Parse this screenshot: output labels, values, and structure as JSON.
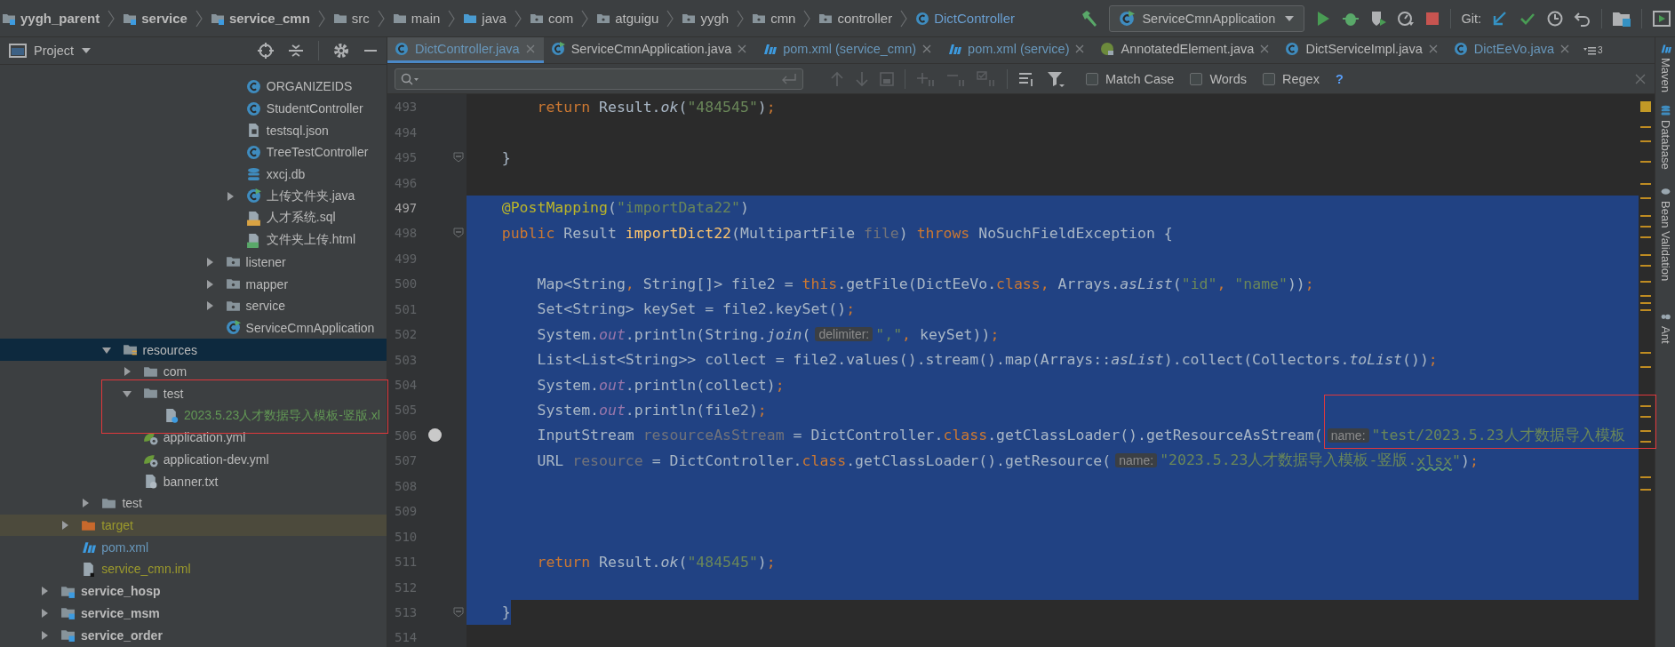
{
  "breadcrumb": [
    {
      "label": "yygh_parent",
      "kind": "module"
    },
    {
      "label": "service",
      "kind": "module"
    },
    {
      "label": "service_cmn",
      "kind": "module"
    },
    {
      "label": "src",
      "kind": "folder"
    },
    {
      "label": "main",
      "kind": "folder"
    },
    {
      "label": "java",
      "kind": "source"
    },
    {
      "label": "com",
      "kind": "package"
    },
    {
      "label": "atguigu",
      "kind": "package"
    },
    {
      "label": "yygh",
      "kind": "package"
    },
    {
      "label": "cmn",
      "kind": "package"
    },
    {
      "label": "controller",
      "kind": "package"
    },
    {
      "label": "DictController",
      "kind": "class"
    }
  ],
  "run_config": {
    "label": "ServiceCmnApplication",
    "kind": "class-run"
  },
  "git": {
    "label": "Git:"
  },
  "project_panel": {
    "title": "Project",
    "tree": [
      {
        "children": [
          {
            "children": [
              {
                "children": [
                  {
                    "children": [
                      {
                        "children": [
                          {
                            "children": [
                              {
                                "children": [
                                  {
                                    "children": [
                                      {
                                        "children": [
                                          {
                                            "label": "ORGANIZEIDS",
                                            "kind": "class",
                                            "selected": false
                                          },
                                          {
                                            "label": "StudentController",
                                            "kind": "class",
                                            "selected": false
                                          },
                                          {
                                            "label": "testsql.json",
                                            "kind": "json",
                                            "selected": false
                                          },
                                          {
                                            "label": "TreeTestController",
                                            "kind": "class",
                                            "selected": false
                                          },
                                          {
                                            "label": "xxcj.db",
                                            "kind": "db",
                                            "selected": false
                                          },
                                          {
                                            "label": "上传文件夹.java",
                                            "kind": "class-run",
                                            "expanded": false,
                                            "selected": false
                                          },
                                          {
                                            "label": "人才系统.sql",
                                            "kind": "sql",
                                            "selected": false
                                          },
                                          {
                                            "label": "文件夹上传.html",
                                            "kind": "html",
                                            "selected": false
                                          }
                                        ]
                                      },
                                      {
                                        "label": "listener",
                                        "kind": "package",
                                        "expanded": false,
                                        "selected": false
                                      },
                                      {
                                        "label": "mapper",
                                        "kind": "package",
                                        "expanded": false,
                                        "selected": false
                                      },
                                      {
                                        "label": "service",
                                        "kind": "package",
                                        "expanded": false,
                                        "selected": false
                                      },
                                      {
                                        "label": "ServiceCmnApplication",
                                        "kind": "class-run",
                                        "selected": false
                                      }
                                    ]
                                  }
                                ]
                              }
                            ]
                          }
                        ]
                      }
                    ]
                  },
                  {
                    "label": "resources",
                    "kind": "resources",
                    "expanded": true,
                    "selected": true,
                    "children": [
                      {
                        "label": "com",
                        "kind": "folder",
                        "expanded": false,
                        "selected": false
                      },
                      {
                        "label": "test",
                        "kind": "folder",
                        "expanded": true,
                        "selected": false,
                        "children": [
                          {
                            "label": "2023.5.23人才数据导入模板-竖版.xl",
                            "kind": "unknown",
                            "color": "#629755",
                            "selected": false
                          }
                        ]
                      },
                      {
                        "label": "application.yml",
                        "kind": "yml",
                        "selected": false
                      },
                      {
                        "label": "application-dev.yml",
                        "kind": "yml",
                        "selected": false
                      },
                      {
                        "label": "banner.txt",
                        "kind": "txt",
                        "selected": false
                      }
                    ]
                  }
                ]
              },
              {
                "label": "test",
                "kind": "folder",
                "expanded": false,
                "selected": false
              }
            ]
          },
          {
            "label": "target",
            "kind": "excluded",
            "expanded": false,
            "color": "#9c9a2c",
            "selected": false
          },
          {
            "label": "pom.xml",
            "kind": "maven",
            "color": "#6897bb",
            "selected": false
          },
          {
            "label": "service_cmn.iml",
            "kind": "iml",
            "color": "#9c9a2c",
            "selected": false
          }
        ]
      },
      {
        "label": "service_hosp",
        "kind": "module",
        "expanded": false,
        "selected": false
      },
      {
        "label": "service_msm",
        "kind": "module",
        "expanded": false,
        "selected": false
      },
      {
        "label": "service_order",
        "kind": "module",
        "expanded": false,
        "selected": false
      }
    ]
  },
  "tabs": [
    {
      "label": "DictController.java",
      "kind": "class",
      "modified": true,
      "selected": true
    },
    {
      "label": "ServiceCmnApplication.java",
      "kind": "class-run",
      "modified": false,
      "selected": false
    },
    {
      "label": "pom.xml (service_cmn)",
      "kind": "maven",
      "modified": true,
      "selected": false
    },
    {
      "label": "pom.xml (service)",
      "kind": "maven",
      "modified": true,
      "selected": false
    },
    {
      "label": "AnnotatedElement.java",
      "kind": "interface",
      "modified": false,
      "selected": false
    },
    {
      "label": "DictServiceImpl.java",
      "kind": "class",
      "modified": false,
      "selected": false
    },
    {
      "label": "DictEeVo.java",
      "kind": "class",
      "modified": true,
      "selected": false
    }
  ],
  "tab_overflow": "3",
  "search": {
    "options": [
      {
        "label": "Match Case",
        "checked": false
      },
      {
        "label": "Words",
        "checked": false
      },
      {
        "label": "Regex",
        "checked": false
      }
    ],
    "help": "?"
  },
  "editor": {
    "lines": [
      {
        "number": "493",
        "selected": false,
        "current": false,
        "breakpoint": false,
        "fold": false,
        "tokens": [
          {
            "text": "        return",
            "kind": "kw"
          },
          {
            "text": " Result."
          },
          {
            "text": "ok",
            "kind": "it"
          },
          {
            "text": "("
          },
          {
            "text": "\"484545\"",
            "kind": "str"
          },
          {
            "text": ")"
          },
          {
            "text": ";",
            "kind": "kw"
          }
        ]
      },
      {
        "number": "494",
        "selected": false,
        "current": false,
        "breakpoint": false,
        "fold": false
      },
      {
        "number": "495",
        "selected": false,
        "current": false,
        "breakpoint": false,
        "fold": true,
        "tokens": [
          {
            "text": "    }"
          }
        ]
      },
      {
        "number": "496",
        "selected": false,
        "current": false,
        "breakpoint": false,
        "fold": false
      },
      {
        "number": "497",
        "selected": true,
        "current": true,
        "breakpoint": false,
        "fold": false,
        "tokens": [
          {
            "text": "    @PostMapping",
            "kind": "ann"
          },
          {
            "text": "("
          },
          {
            "text": "\"importData22\"",
            "kind": "str"
          },
          {
            "text": ")"
          }
        ]
      },
      {
        "number": "498",
        "selected": true,
        "current": false,
        "breakpoint": false,
        "fold": true,
        "tokens": [
          {
            "text": "    public",
            "kind": "kw"
          },
          {
            "text": " Result "
          },
          {
            "text": "importDict22",
            "kind": "meth"
          },
          {
            "text": "(MultipartFile "
          },
          {
            "text": "file",
            "kind": "unused"
          },
          {
            "text": ") "
          },
          {
            "text": "throws",
            "kind": "kw"
          },
          {
            "text": " NoSuchFieldException {"
          }
        ]
      },
      {
        "number": "499",
        "selected": true,
        "current": false,
        "breakpoint": false,
        "fold": false
      },
      {
        "number": "500",
        "selected": true,
        "current": false,
        "breakpoint": false,
        "fold": false,
        "tokens": [
          {
            "text": "        Map<String"
          },
          {
            "text": ",",
            "kind": "kw"
          },
          {
            "text": " String[]> file2 = "
          },
          {
            "text": "this",
            "kind": "kw"
          },
          {
            "text": ".getFile(DictEeVo."
          },
          {
            "text": "class",
            "kind": "kw"
          },
          {
            "text": ",",
            "kind": "kw"
          },
          {
            "text": " Arrays."
          },
          {
            "text": "asList",
            "kind": "it"
          },
          {
            "text": "("
          },
          {
            "text": "\"id\"",
            "kind": "str"
          },
          {
            "text": ", ",
            "kind": "kw"
          },
          {
            "text": "\"name\"",
            "kind": "str"
          },
          {
            "text": "))"
          },
          {
            "text": ";",
            "kind": "kw"
          }
        ]
      },
      {
        "number": "501",
        "selected": true,
        "current": false,
        "breakpoint": false,
        "fold": false,
        "tokens": [
          {
            "text": "        Set<String> keySet = file2.keySet()"
          },
          {
            "text": ";",
            "kind": "kw"
          }
        ]
      },
      {
        "number": "502",
        "selected": true,
        "current": false,
        "breakpoint": false,
        "fold": false,
        "tokens": [
          {
            "text": "        System."
          },
          {
            "text": "out",
            "kind": "st"
          },
          {
            "text": ".println(String."
          },
          {
            "text": "join",
            "kind": "it"
          },
          {
            "text": "("
          },
          {
            "text": "delimiter:",
            "kind": "hint"
          },
          {
            "text": "\",\"",
            "kind": "str"
          },
          {
            "text": ",",
            "kind": "kw"
          },
          {
            "text": " keySet))"
          },
          {
            "text": ";",
            "kind": "kw"
          }
        ]
      },
      {
        "number": "503",
        "selected": true,
        "current": false,
        "breakpoint": false,
        "fold": false,
        "tokens": [
          {
            "text": "        List<List<String>> collect = file2.values().stream().map(Arrays::"
          },
          {
            "text": "asList",
            "kind": "it"
          },
          {
            "text": ").collect(Collectors."
          },
          {
            "text": "toList",
            "kind": "it"
          },
          {
            "text": "())"
          },
          {
            "text": ";",
            "kind": "kw"
          }
        ]
      },
      {
        "number": "504",
        "selected": true,
        "current": false,
        "breakpoint": false,
        "fold": false,
        "tokens": [
          {
            "text": "        System."
          },
          {
            "text": "out",
            "kind": "st"
          },
          {
            "text": ".println(collect)"
          },
          {
            "text": ";",
            "kind": "kw"
          }
        ]
      },
      {
        "number": "505",
        "selected": true,
        "current": false,
        "breakpoint": false,
        "fold": false,
        "tokens": [
          {
            "text": "        System."
          },
          {
            "text": "out",
            "kind": "st"
          },
          {
            "text": ".println(file2)"
          },
          {
            "text": ";",
            "kind": "kw"
          }
        ]
      },
      {
        "number": "506",
        "selected": true,
        "current": false,
        "breakpoint": true,
        "fold": false,
        "tokens": [
          {
            "text": "        InputStream "
          },
          {
            "text": "resourceAsStream",
            "kind": "unused"
          },
          {
            "text": " = DictController."
          },
          {
            "text": "class",
            "kind": "kw"
          },
          {
            "text": ".getClassLoader().getResourceAsStream("
          },
          {
            "text": "name:",
            "kind": "hint"
          },
          {
            "text": "\"test/2023.5.23人才数据导入模板",
            "kind": "str"
          }
        ]
      },
      {
        "number": "507",
        "selected": true,
        "current": false,
        "breakpoint": false,
        "fold": false,
        "tokens": [
          {
            "text": "        URL "
          },
          {
            "text": "resource",
            "kind": "unused"
          },
          {
            "text": " = DictController."
          },
          {
            "text": "class",
            "kind": "kw"
          },
          {
            "text": ".getClassLoader().getResource("
          },
          {
            "text": "name:",
            "kind": "hint"
          },
          {
            "text": "\"2023.5.23人才数据导入模板-竖版.",
            "kind": "str"
          },
          {
            "text": "xlsx",
            "kind": "typo"
          },
          {
            "text": "\"",
            "kind": "str"
          },
          {
            "text": ")"
          },
          {
            "text": ";",
            "kind": "kw"
          }
        ]
      },
      {
        "number": "508",
        "selected": true,
        "current": false,
        "breakpoint": false,
        "fold": false
      },
      {
        "number": "509",
        "selected": true,
        "current": false,
        "breakpoint": false,
        "fold": false
      },
      {
        "number": "510",
        "selected": true,
        "current": false,
        "breakpoint": false,
        "fold": false
      },
      {
        "number": "511",
        "selected": true,
        "current": false,
        "breakpoint": false,
        "fold": false,
        "tokens": [
          {
            "text": "        return",
            "kind": "kw"
          },
          {
            "text": " Result."
          },
          {
            "text": "ok",
            "kind": "it"
          },
          {
            "text": "("
          },
          {
            "text": "\"484545\"",
            "kind": "str"
          },
          {
            "text": ")"
          },
          {
            "text": ";",
            "kind": "kw"
          }
        ]
      },
      {
        "number": "512",
        "selected": true,
        "current": false,
        "breakpoint": false,
        "fold": false
      },
      {
        "number": "513",
        "selected": true,
        "current": false,
        "breakpoint": false,
        "fold": true,
        "tokens": [
          {
            "text": "    }"
          }
        ]
      },
      {
        "number": "514",
        "selected": false,
        "current": false,
        "breakpoint": false,
        "fold": false
      }
    ]
  },
  "side_tools": [
    {
      "label": "Maven",
      "kind": "maven"
    },
    {
      "label": "Database",
      "kind": "db"
    },
    {
      "label": "Bean Validation",
      "kind": "bean"
    },
    {
      "label": "Ant",
      "kind": "ant"
    }
  ]
}
